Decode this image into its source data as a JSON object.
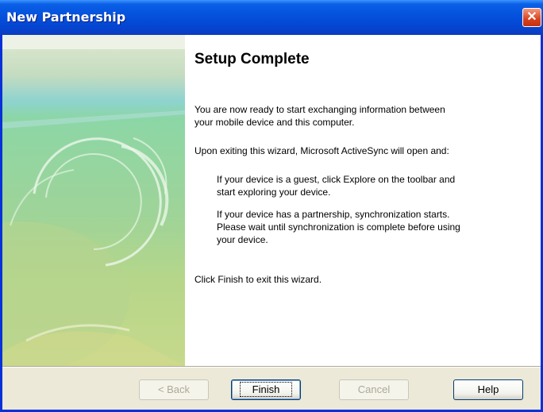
{
  "window": {
    "title": "New Partnership"
  },
  "page": {
    "heading": "Setup Complete",
    "para1": "You are now ready to start exchanging information between\nyour mobile device and this computer.",
    "para2": "Upon exiting this wizard, Microsoft ActiveSync will open and:",
    "para3": "If your device is a guest, click Explore on the toolbar and\nstart exploring your device.",
    "para4": "If your device has a partnership, synchronization starts.\nPlease wait until synchronization is complete before using\nyour device.",
    "para5": "Click Finish to exit this wizard."
  },
  "buttons": {
    "back": "< Back",
    "finish": "Finish",
    "cancel": "Cancel",
    "help": "Help"
  },
  "icons": {
    "close": "close-icon"
  }
}
